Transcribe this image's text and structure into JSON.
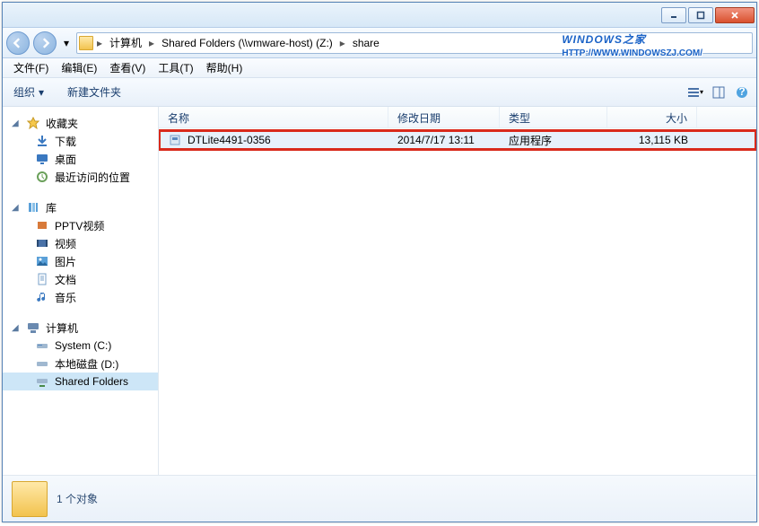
{
  "window_controls": {
    "min": "minimize",
    "max": "maximize",
    "close": "close"
  },
  "breadcrumb": {
    "items": [
      "计算机",
      "Shared Folders (\\\\vmware-host) (Z:)",
      "share"
    ]
  },
  "watermark": {
    "brand": "WINDOWS之家",
    "url": "HTTP://WWW.WINDOWSZJ.COM/"
  },
  "menu": {
    "file": "文件(F)",
    "edit": "编辑(E)",
    "view": "查看(V)",
    "tools": "工具(T)",
    "help": "帮助(H)"
  },
  "toolbar": {
    "organize": "组织",
    "new_folder": "新建文件夹"
  },
  "sidebar": {
    "favorites": {
      "label": "收藏夹",
      "items": [
        "下载",
        "桌面",
        "最近访问的位置"
      ]
    },
    "libraries": {
      "label": "库",
      "items": [
        "PPTV视频",
        "视频",
        "图片",
        "文档",
        "音乐"
      ]
    },
    "computer": {
      "label": "计算机",
      "items": [
        "System (C:)",
        "本地磁盘 (D:)",
        "Shared Folders"
      ]
    }
  },
  "columns": {
    "name": "名称",
    "modified": "修改日期",
    "type": "类型",
    "size": "大小"
  },
  "col_widths": {
    "name": 256,
    "modified": 124,
    "type": 120,
    "size": 100
  },
  "files": [
    {
      "name": "DTLite4491-0356",
      "modified": "2014/7/17 13:11",
      "type": "应用程序",
      "size": "13,115 KB",
      "selected": true,
      "highlight": true
    }
  ],
  "status": {
    "text": "1 个对象"
  }
}
